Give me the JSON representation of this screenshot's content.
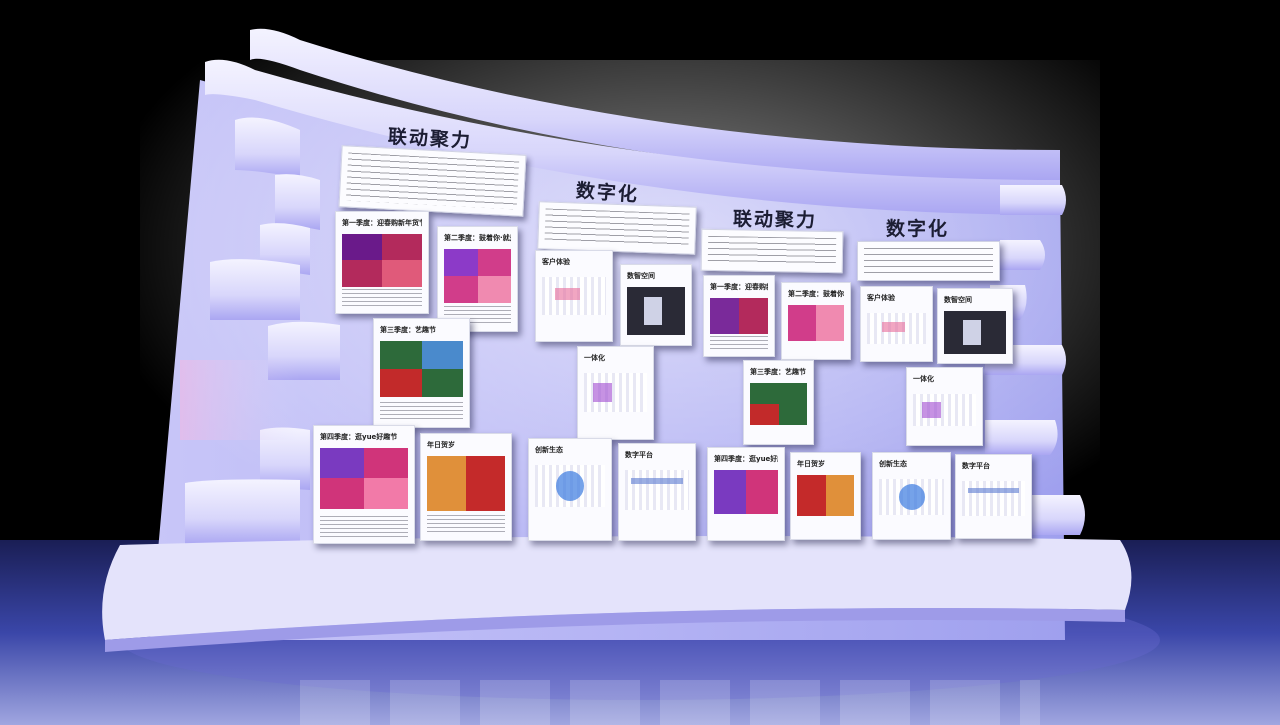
{
  "scene": {
    "headings": [
      "联动聚力",
      "数字化",
      "联动聚力",
      "数字化"
    ],
    "colors": {
      "wall": "#e3e2fb",
      "wall_shadow": "#8a86e8",
      "floor": "#2a2f7a",
      "background": "#000000",
      "accent_red": "#c42a4a"
    },
    "panels": [
      {
        "title": "第一季度：迎春购新年货节",
        "kind": "photo"
      },
      {
        "title": "第二季度：鼓着你·就是你·暖在节",
        "kind": "photo"
      },
      {
        "title": "客户体验",
        "kind": "chart"
      },
      {
        "title": "数智空间",
        "kind": "dark"
      },
      {
        "title": "第一季度：迎春购新年货节",
        "kind": "photo"
      },
      {
        "title": "第二季度：鼓着你·就是你·暖在节",
        "kind": "photo"
      },
      {
        "title": "客户体验",
        "kind": "chart"
      },
      {
        "title": "数智空间",
        "kind": "dark"
      },
      {
        "title": "第三季度：艺趣节",
        "kind": "photo"
      },
      {
        "title": "一体化",
        "kind": "chart"
      },
      {
        "title": "第三季度：艺趣节",
        "kind": "photo"
      },
      {
        "title": "一体化",
        "kind": "chart"
      },
      {
        "title": "第四季度：逛yue好趣节",
        "kind": "photo"
      },
      {
        "title": "年日贺岁",
        "kind": "photo"
      },
      {
        "title": "创新生态",
        "kind": "chart"
      },
      {
        "title": "数字平台",
        "kind": "chart"
      },
      {
        "title": "第四季度：逛yue好趣节",
        "kind": "photo"
      },
      {
        "title": "年日贺岁",
        "kind": "photo"
      },
      {
        "title": "创新生态",
        "kind": "chart"
      },
      {
        "title": "数字平台",
        "kind": "chart"
      }
    ]
  }
}
